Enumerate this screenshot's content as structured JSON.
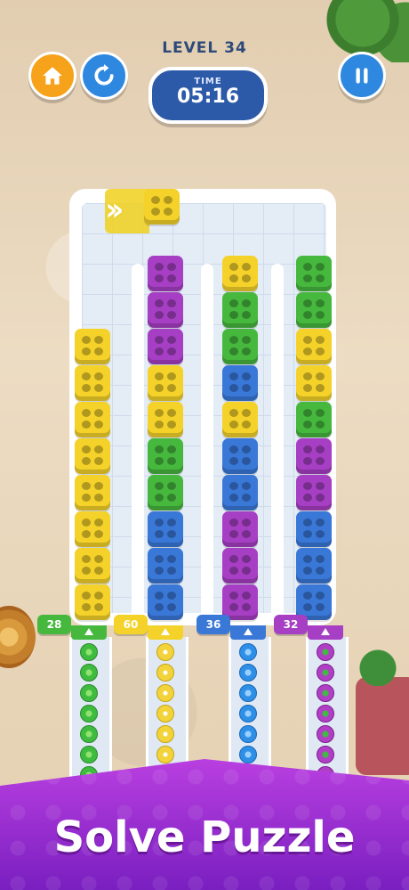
{
  "level": {
    "label": "LEVEL 34"
  },
  "timer": {
    "label": "TIME",
    "value": "05:16"
  },
  "buttons": {
    "home": {
      "icon": "home-icon",
      "color": "#f6a21a"
    },
    "restart": {
      "icon": "restart-icon",
      "color": "#2f88e0"
    },
    "pause": {
      "icon": "pause-icon",
      "color": "#2f88e0"
    }
  },
  "colors": {
    "yellow": "#f4d229",
    "purple": "#a63fc3",
    "green": "#46b83e",
    "blue": "#3a78d8"
  },
  "incoming_block": "yellow",
  "columns": [
    {
      "blocks": [
        "yellow",
        "yellow",
        "yellow",
        "yellow",
        "yellow",
        "yellow",
        "yellow",
        "yellow"
      ]
    },
    {
      "blocks": [
        "purple",
        "purple",
        "purple",
        "yellow",
        "yellow",
        "green",
        "green",
        "blue",
        "blue",
        "blue"
      ]
    },
    {
      "blocks": [
        "yellow",
        "green",
        "green",
        "blue",
        "yellow",
        "blue",
        "blue",
        "purple",
        "purple",
        "purple"
      ]
    },
    {
      "blocks": [
        "green",
        "green",
        "yellow",
        "yellow",
        "green",
        "purple",
        "purple",
        "blue",
        "blue",
        "blue"
      ]
    }
  ],
  "counters": [
    {
      "value": "28",
      "color": "green",
      "gem": "green"
    },
    {
      "value": "60",
      "color": "yellow",
      "gem": "yellow"
    },
    {
      "value": "36",
      "color": "blue",
      "gem": "blue"
    },
    {
      "value": "32",
      "color": "purple",
      "gem": "purple"
    }
  ],
  "banner": {
    "title": "Solve Puzzle"
  }
}
